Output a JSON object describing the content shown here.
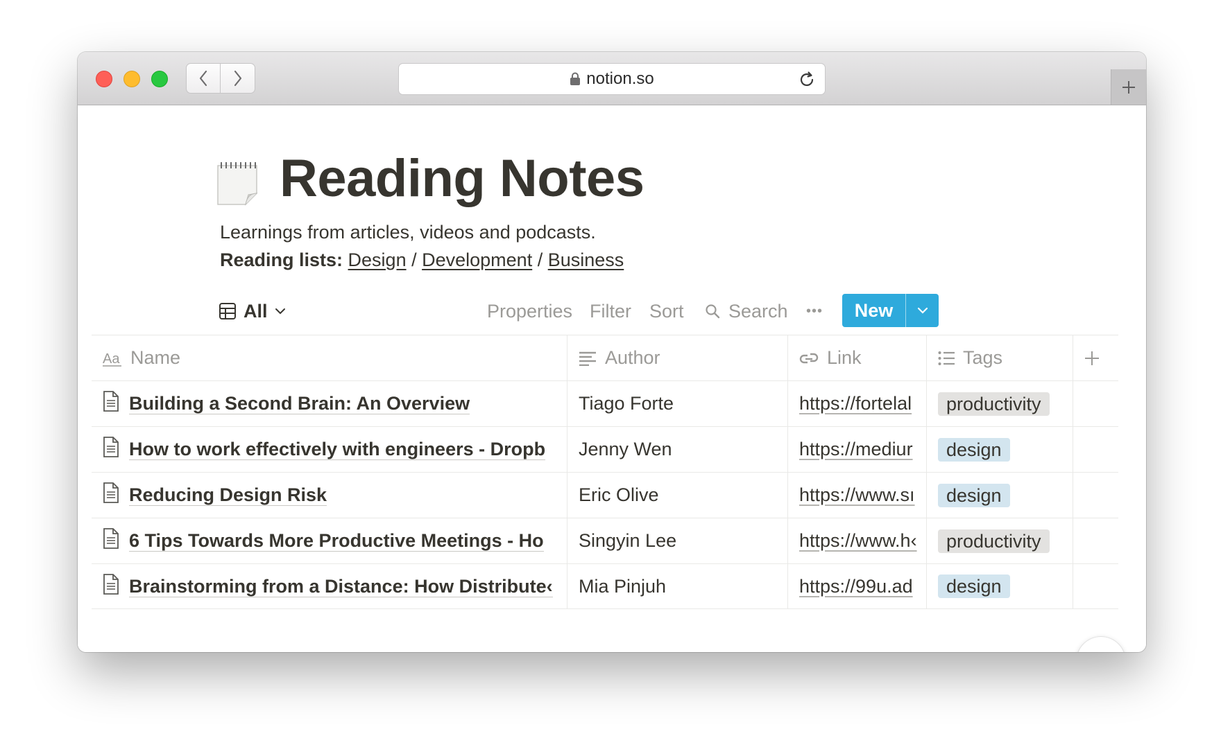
{
  "browser": {
    "url": "notion.so"
  },
  "page": {
    "icon": "spiral-notepad-icon",
    "title": "Reading Notes",
    "description": "Learnings from articles, videos and podcasts.",
    "reading_lists_label": "Reading lists:",
    "reading_lists": [
      "Design",
      "Development",
      "Business"
    ],
    "separator": " / "
  },
  "toolbar": {
    "view_name": "All",
    "properties": "Properties",
    "filter": "Filter",
    "sort": "Sort",
    "search": "Search",
    "more": "•••",
    "new_label": "New"
  },
  "table": {
    "columns": [
      {
        "label": "Name",
        "icon": "title-aa-icon"
      },
      {
        "label": "Author",
        "icon": "text-lines-icon"
      },
      {
        "label": "Link",
        "icon": "url-link-icon"
      },
      {
        "label": "Tags",
        "icon": "multi-select-list-icon"
      }
    ],
    "rows": [
      {
        "name": "Building a Second Brain: An Overview",
        "author": "Tiago Forte",
        "link": "https://fortelal",
        "tag": "productivity"
      },
      {
        "name": "How to work effectively with engineers - Dropb",
        "author": "Jenny Wen",
        "link": "https://mediur",
        "tag": "design"
      },
      {
        "name": "Reducing Design Risk",
        "author": "Eric Olive",
        "link": "https://www.sı",
        "tag": "design"
      },
      {
        "name": "6 Tips Towards More Productive Meetings - Ho",
        "author": "Singyin Lee",
        "link": "https://www.h‹",
        "tag": "productivity"
      },
      {
        "name": "Brainstorming from a Distance: How Distribute‹",
        "author": "Mia Pinjuh",
        "link": "https://99u.ad",
        "tag": "design"
      }
    ]
  },
  "tag_colors": {
    "productivity": "#e3e2e0",
    "design": "#d3e5ef"
  },
  "accent_color": "#2eaadc",
  "help_label": "?"
}
